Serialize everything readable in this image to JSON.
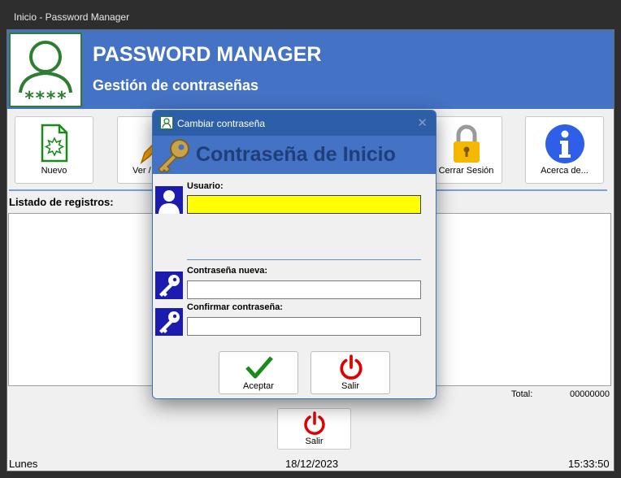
{
  "window": {
    "title": "Inicio - Password Manager"
  },
  "header": {
    "title": "PASSWORD MANAGER",
    "subtitle": "Gestión de contraseñas"
  },
  "toolbar": {
    "new_label": "Nuevo",
    "view_label": "Ver /",
    "logout_label": "Cerrar Sesión",
    "about_label": "Acerca de..."
  },
  "records": {
    "label": "Listado de registros:",
    "total_label": "Total:",
    "total_value": "00000000"
  },
  "main_exit_label": "Salir",
  "statusbar": {
    "day": "Lunes",
    "date": "18/12/2023",
    "time": "15:33:50"
  },
  "dialog": {
    "title": "Cambiar contraseña",
    "banner": "Contraseña de Inicio",
    "user_label": "Usuario:",
    "user_value": "",
    "new_password_label": "Contraseña nueva:",
    "new_password_value": "",
    "confirm_password_label": "Confirmar contraseña:",
    "confirm_password_value": "",
    "accept_label": "Aceptar",
    "exit_label": "Salir"
  },
  "colors": {
    "accent": "#4472c4",
    "dialog_title": "#2c5fa8",
    "focus_field": "#ffff00",
    "exit_red": "#e00000",
    "check_green": "#1a8a1a"
  }
}
